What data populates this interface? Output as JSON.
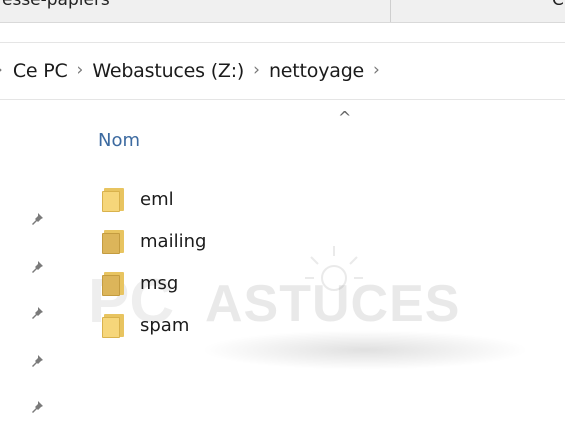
{
  "tab_strip": {
    "left_text": "esse-papiers",
    "right_text": "C"
  },
  "address_bar": {
    "crumbs": [
      "Ce PC",
      "Webastuces (Z:)",
      "nettoyage"
    ]
  },
  "file_list": {
    "column_header": "Nom",
    "items": [
      {
        "name": "eml",
        "icon": "folder-icon"
      },
      {
        "name": "mailing",
        "icon": "folder-icon"
      },
      {
        "name": "msg",
        "icon": "folder-icon"
      },
      {
        "name": "spam",
        "icon": "folder-icon"
      }
    ]
  },
  "quick_access_pins": [
    "pin-icon",
    "pin-icon",
    "pin-icon",
    "pin-icon",
    "pin-icon"
  ],
  "watermark": {
    "text_pc": "PC",
    "text_astuces": "ASTUCES"
  },
  "colors": {
    "header_text": "#3c6aa0",
    "folder_fill": "#f6d67a",
    "folder_border": "#d9b24c"
  }
}
